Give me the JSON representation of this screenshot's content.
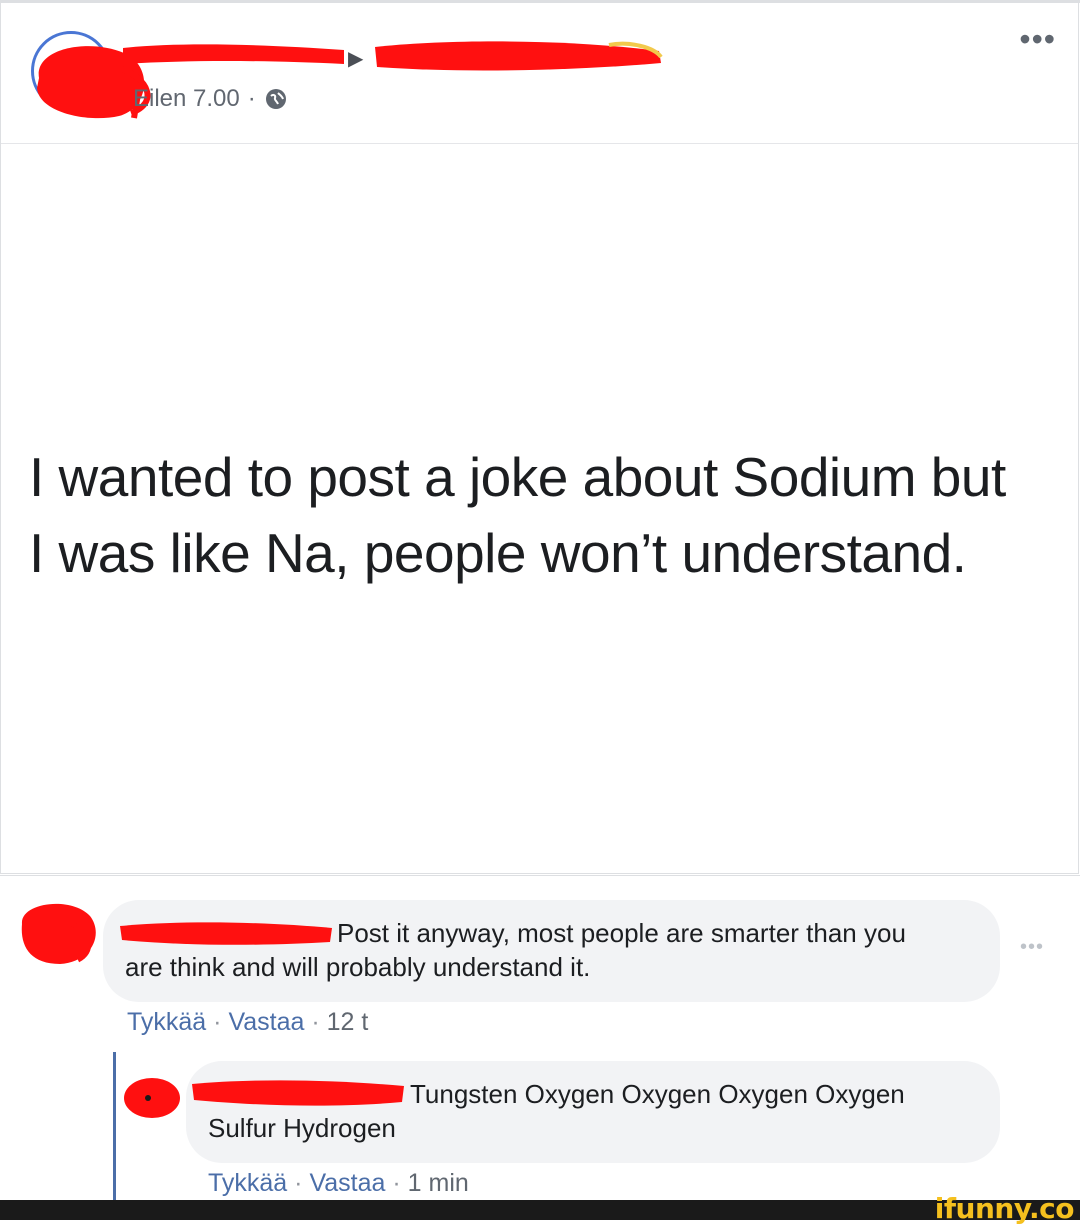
{
  "post": {
    "timestamp": "Eilen 7.00",
    "timestamp_dot": "·",
    "privacy_icon": "globe-icon",
    "more_icon": "more-options-icon",
    "more_glyph": "•••",
    "text_line1": "I wanted to post a joke about Sodium but",
    "text_line2": "I was like Na, people won’t understand."
  },
  "comments": [
    {
      "text_line1": "Post it anyway, most people are smarter than you",
      "text_line2": "are think and will probably understand it.",
      "like": "Tykkää",
      "reply": "Vastaa",
      "time": "12 t"
    },
    {
      "text_line1": "Tungsten Oxygen Oxygen Oxygen Oxygen",
      "text_line2": "Sulfur Hydrogen",
      "like": "Tykkää",
      "reply": "Vastaa",
      "time": "1 min"
    }
  ],
  "dot": "·",
  "comment_more_glyph": "•••",
  "watermark": "ifunny.co",
  "colors": {
    "redaction": "#ff1010",
    "link": "#4b6ea8",
    "bubble": "#f2f3f5",
    "brand": "#f5c01e"
  }
}
